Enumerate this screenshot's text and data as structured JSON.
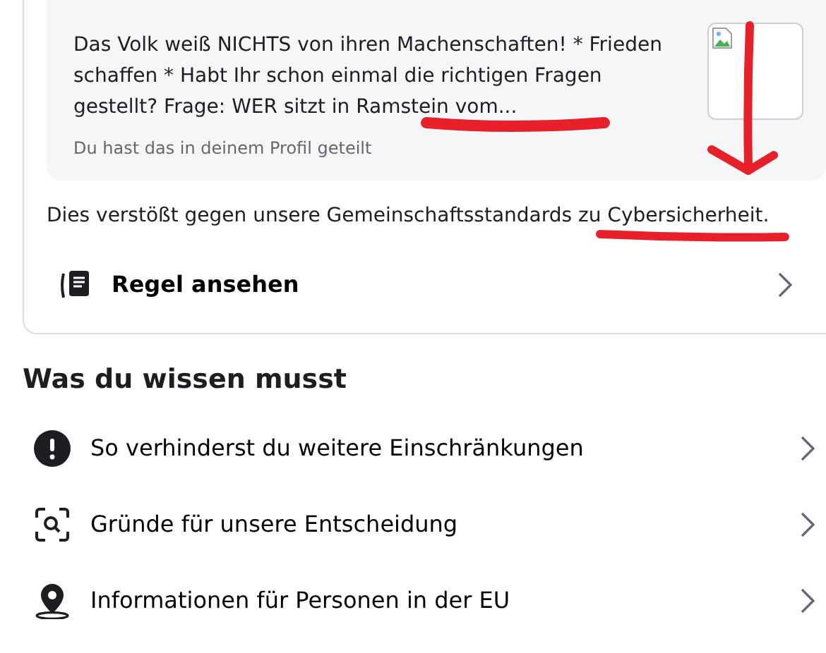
{
  "post_preview": {
    "text": "Das Volk weiß NICHTS von ihren Machenschaften! * Frieden schaffen * Habt Ihr schon einmal die richtigen Fragen gestellt? Frage: WER sitzt in Ramstein vom...",
    "note": "Du hast das in deinem Profil geteilt"
  },
  "statement": "Dies verstößt gegen unsere Gemeinschaftsstandards zu Cybersicherheit.",
  "rule_link": {
    "label": "Regel ansehen"
  },
  "section_title": "Was du wissen musst",
  "items": [
    {
      "label": "So verhinderst du weitere Einschränkungen",
      "kind": "alert"
    },
    {
      "label": "Gründe für unsere Entscheidung",
      "kind": "search"
    },
    {
      "label": "Informationen für Personen in der EU",
      "kind": "location"
    }
  ]
}
